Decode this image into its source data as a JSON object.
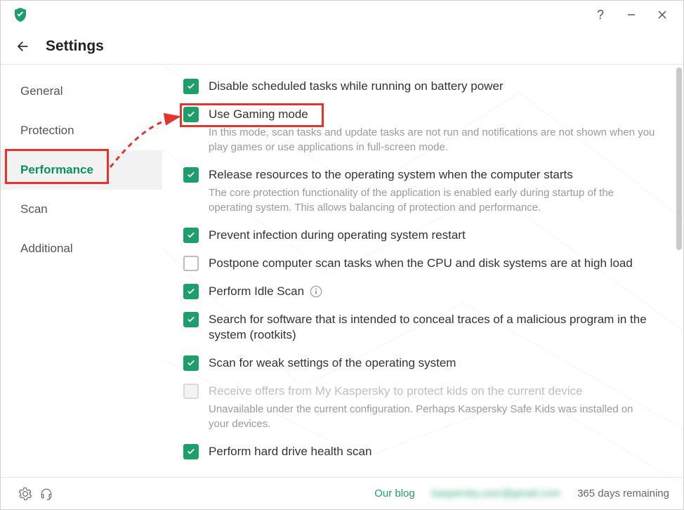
{
  "title": "Settings",
  "titlebar": {
    "help": "?"
  },
  "sidebar": {
    "items": [
      {
        "label": "General"
      },
      {
        "label": "Protection"
      },
      {
        "label": "Performance"
      },
      {
        "label": "Scan"
      },
      {
        "label": "Additional"
      }
    ],
    "active_index": 2
  },
  "settings": [
    {
      "label": "Disable scheduled tasks while running on battery power",
      "checked": true
    },
    {
      "label": "Use Gaming mode",
      "checked": true,
      "desc": "In this mode, scan tasks and update tasks are not run and notifications are not shown when you play games or use applications in full-screen mode."
    },
    {
      "label": "Release resources to the operating system when the computer starts",
      "checked": true,
      "desc": "The core protection functionality of the application is enabled early during startup of the operating system. This allows balancing of protection and performance."
    },
    {
      "label": "Prevent infection during operating system restart",
      "checked": true
    },
    {
      "label": "Postpone computer scan tasks when the CPU and disk systems are at high load",
      "checked": false
    },
    {
      "label": "Perform Idle Scan",
      "checked": true,
      "info": true
    },
    {
      "label": "Search for software that is intended to conceal traces of a malicious program in the system (rootkits)",
      "checked": true
    },
    {
      "label": "Scan for weak settings of the operating system",
      "checked": true
    },
    {
      "label": "Receive offers from My Kaspersky to protect kids on the current device",
      "checked": false,
      "disabled": true,
      "desc": "Unavailable under the current configuration. Perhaps Kaspersky Safe Kids was installed on your devices."
    },
    {
      "label": "Perform hard drive health scan",
      "checked": true
    }
  ],
  "footer": {
    "blog": "Our blog",
    "email": "kaspersky.user@gmail.com",
    "remaining": "365 days remaining"
  },
  "colors": {
    "accent": "#1d9e6a",
    "annotation": "#e5342e"
  }
}
